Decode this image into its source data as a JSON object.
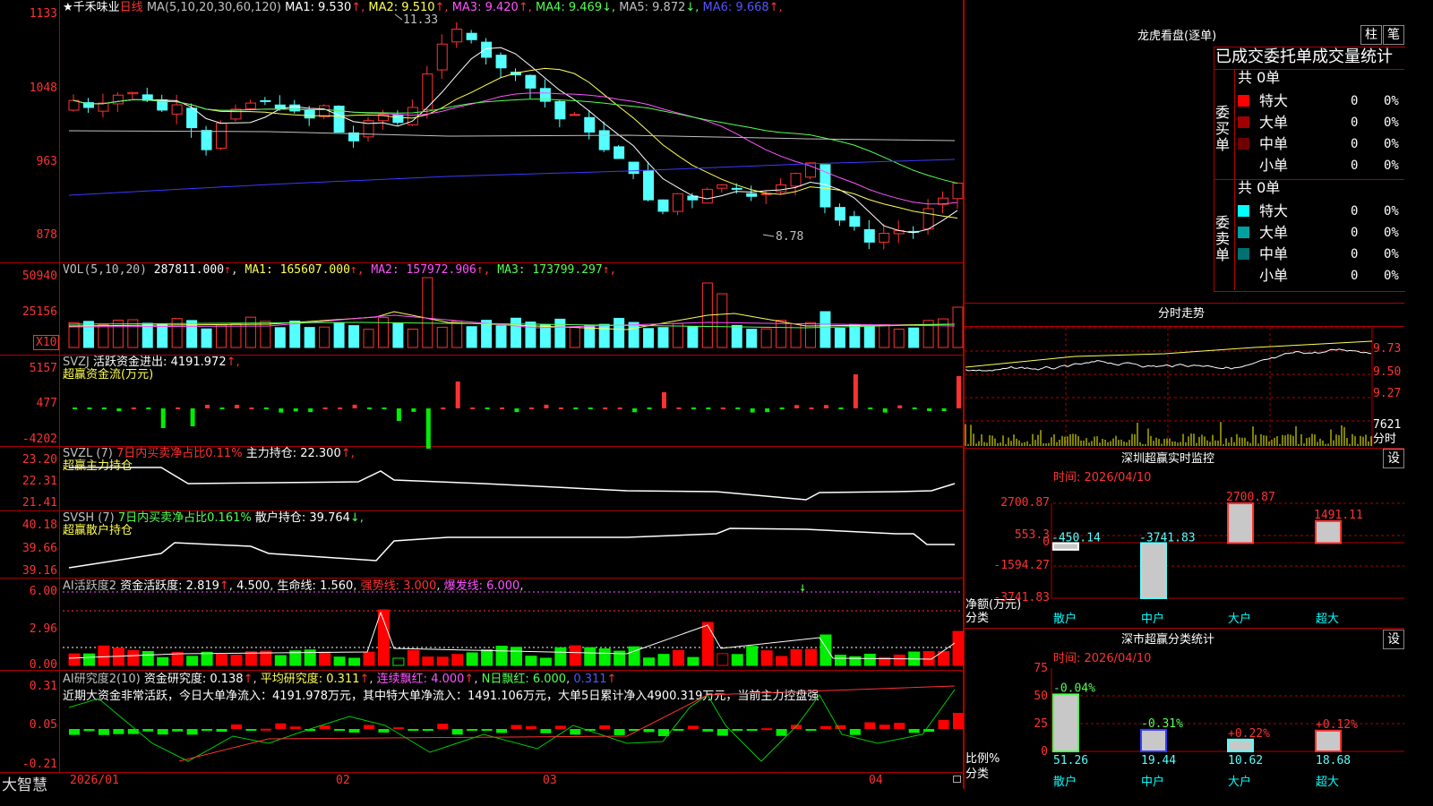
{
  "stock": {
    "star": "★",
    "name": "千禾味业",
    "period": "日线"
  },
  "price_panel": {
    "ma_title": "MA(5,10,20,30,60,120)",
    "ma_items": [
      {
        "label": "MA1:",
        "value": "9.530",
        "arrow": "↑",
        "color": "#ffffff"
      },
      {
        "label": "MA2:",
        "value": "9.510",
        "arrow": "↑",
        "color": "#ffff54"
      },
      {
        "label": "MA3:",
        "value": "9.420",
        "arrow": "↑",
        "color": "#ff54ff"
      },
      {
        "label": "MA4:",
        "value": "9.469",
        "arrow": "↓",
        "color": "#54ff54"
      },
      {
        "label": "MA5:",
        "value": "9.872",
        "arrow": "↓",
        "color": "#c0c0c0"
      },
      {
        "label": "MA6:",
        "value": "9.668",
        "arrow": "↑",
        "color": "#5454ff"
      }
    ],
    "y_ticks": [
      "1133",
      "1048",
      "963",
      "878"
    ],
    "high_label": "11.33",
    "low_label": "8.78"
  },
  "vol_panel": {
    "title": "VOL(5,10,20)",
    "value": "287811.000",
    "arrow": "↑",
    "ma_items": [
      {
        "label": "MA1:",
        "value": "165607.000",
        "arrow": "↑",
        "color": "#ffff54"
      },
      {
        "label": "MA2:",
        "value": "157972.906",
        "arrow": "↑",
        "color": "#ff54ff"
      },
      {
        "label": "MA3:",
        "value": "173799.297",
        "arrow": "↑",
        "color": "#54ff54"
      }
    ],
    "y_ticks": [
      "50940",
      "25156"
    ],
    "unit": "X10"
  },
  "svzj_panel": {
    "title": "SVZJ",
    "label": "活跃资金进出:",
    "value": "4191.972",
    "arrow": "↑,",
    "subtitle": "超赢资金流(万元)",
    "y_ticks": [
      "5157",
      "477",
      "-4202"
    ]
  },
  "svzl_panel": {
    "title": "SVZL (7)",
    "pct_label": "7日内买卖净占比0.11%",
    "label": "主力持仓:",
    "value": "22.300",
    "arrow": "↑,",
    "subtitle": "超赢主力持仓",
    "y_ticks": [
      "23.20",
      "22.31",
      "21.41"
    ]
  },
  "svsh_panel": {
    "title": "SVSH (7)",
    "pct_label": "7日内买卖净占比0.161%",
    "label": "散户持仓:",
    "value": "39.764",
    "arrow": "↓,",
    "subtitle": "超赢散户持仓",
    "y_ticks": [
      "40.18",
      "39.66",
      "39.16"
    ]
  },
  "ai_active_panel": {
    "title": "AI活跃度2",
    "label": "资金活跃度:",
    "value": "2.819",
    "arrow": "↑",
    "v2": "4.500",
    "life_label": "生命线:",
    "life_value": "1.560",
    "strong_label": "强势线:",
    "strong_value": "3.000",
    "burst_label": "爆发线:",
    "burst_value": "6.000",
    "y_ticks": [
      "6.00",
      "2.96",
      "0.00"
    ]
  },
  "ai_research_panel": {
    "title": "AI研究度2(10)",
    "label": "资金研究度:",
    "value": "0.138",
    "arrow": "↑",
    "avg_label": "平均研究度:",
    "avg_value": "0.311",
    "cont_label": "连续飘红:",
    "cont_value": "4.000",
    "n_label": "N日飘红:",
    "n_value": "6.000",
    "last_value": "0.311",
    "summary": "近期大资金非常活跃，今日大单净流入：4191.978万元，其中特大单净流入：1491.106万元，大单5日累计净入4900.319万元，当前主力控盘强",
    "y_ticks": [
      "0.31",
      "0.05",
      "-0.21"
    ]
  },
  "x_axis": {
    "labels": [
      "2026/01",
      "02",
      "03",
      "04"
    ]
  },
  "brand": "大智慧",
  "dragon": {
    "title": "龙虎看盘(逐单)",
    "btn1": "柱",
    "btn2": "笔",
    "header": "已成交委托单成交量统计",
    "buy": {
      "side": "委买单",
      "count": "共 0单",
      "rows": [
        {
          "label": "特大",
          "v": "0",
          "p": "0%",
          "color": "#ff0000"
        },
        {
          "label": "大单",
          "v": "0",
          "p": "0%",
          "color": "#a00000"
        },
        {
          "label": "中单",
          "v": "0",
          "p": "0%",
          "color": "#700000"
        },
        {
          "label": "小单",
          "v": "0",
          "p": "0%",
          "color": ""
        }
      ]
    },
    "sell": {
      "side": "委卖单",
      "count": "共 0单",
      "rows": [
        {
          "label": "特大",
          "v": "0",
          "p": "0%",
          "color": "#00ffff"
        },
        {
          "label": "大单",
          "v": "0",
          "p": "0%",
          "color": "#00a0a0"
        },
        {
          "label": "中单",
          "v": "0",
          "p": "0%",
          "color": "#007070"
        },
        {
          "label": "小单",
          "v": "0",
          "p": "0%",
          "color": ""
        }
      ]
    }
  },
  "intraday": {
    "title": "分时走势",
    "y_ticks": [
      "9.73",
      "9.50",
      "9.27"
    ],
    "vol_label": "7621",
    "vol_unit": "分时"
  },
  "sz_monitor": {
    "title": "深圳超赢实时监控",
    "btn": "设",
    "time": "时间: 2026/04/10",
    "ylabel": "净额(万元)",
    "xcat": "分类",
    "y_ticks": [
      "2700.87",
      "553.3",
      "0",
      "-1594.27",
      "-3741.83"
    ],
    "categories": [
      "散户",
      "中户",
      "大户",
      "超大"
    ],
    "values": [
      -450.14,
      -3741.83,
      2700.87,
      1491.11
    ],
    "value_labels": [
      "-450.14",
      "-3741.83",
      "2700.87",
      "1491.11"
    ]
  },
  "sz_class": {
    "title": "深市超赢分类统计",
    "btn": "设",
    "time": "时间: 2026/04/10",
    "ylabel": "比例%",
    "xcat": "分类",
    "y_ticks": [
      "75",
      "50",
      "25",
      "0"
    ],
    "categories": [
      "散户",
      "中户",
      "大户",
      "超大"
    ],
    "values": [
      51.26,
      19.44,
      10.62,
      18.68
    ],
    "changes": [
      "-0.04%",
      "-0.31%",
      "+0.22%",
      "+0.12%"
    ]
  },
  "chart_data": [
    {
      "type": "candlestick",
      "title": "",
      "xlabel": "",
      "ylabel": "",
      "note": "千禾味业 daily K-line, price range approx 8.78–11.33",
      "high": 11.33,
      "low": 8.78,
      "ylim": [
        8.6,
        11.5
      ],
      "x": [
        "2026/01",
        "02",
        "03",
        "04"
      ]
    },
    {
      "type": "bar",
      "title": "",
      "xlabel": "",
      "ylabel": "",
      "sz_net_flow_categories": [
        "散户",
        "中户",
        "大户",
        "超大"
      ],
      "values": [
        -450.14,
        -3741.83,
        2700.87,
        1491.11
      ],
      "ylim": [
        -3741.83,
        2700.87
      ]
    },
    {
      "type": "bar",
      "title": "",
      "xlabel": "",
      "ylabel": "",
      "categories": [
        "散户",
        "中户",
        "大户",
        "超大"
      ],
      "values": [
        51.26,
        19.44,
        10.62,
        18.68
      ],
      "ylim": [
        0,
        75
      ]
    }
  ]
}
